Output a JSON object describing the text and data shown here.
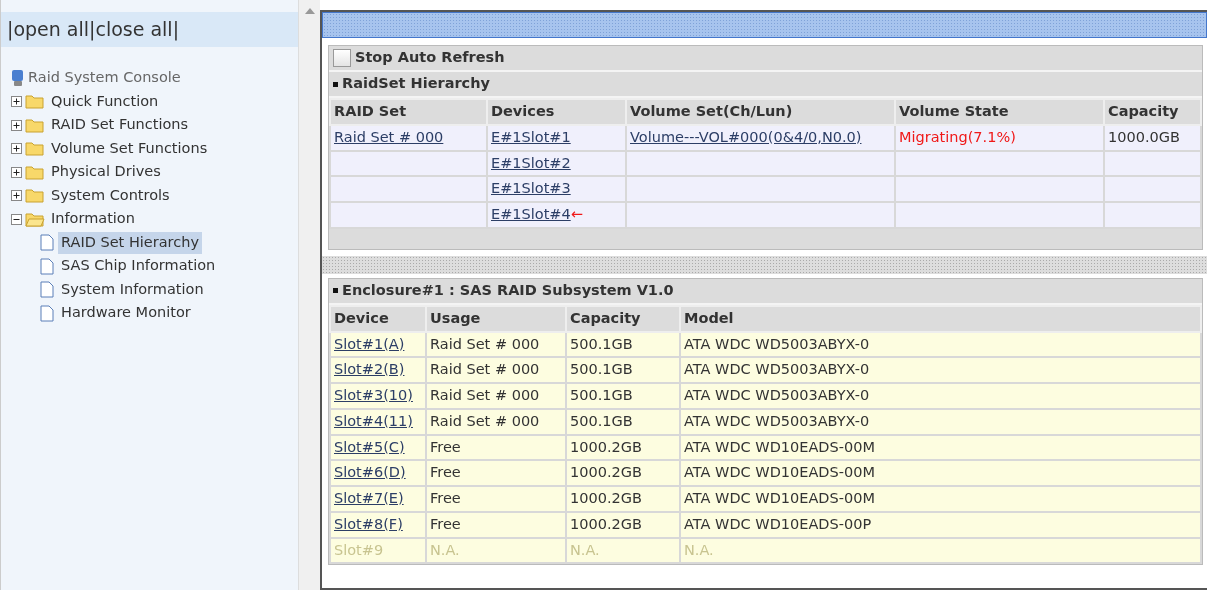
{
  "sidebar": {
    "header_links": [
      "|open all|close all|"
    ],
    "root": "Raid System Console",
    "items": [
      {
        "label": "Quick Function",
        "expanded": false
      },
      {
        "label": "RAID Set Functions",
        "expanded": false
      },
      {
        "label": "Volume Set Functions",
        "expanded": false
      },
      {
        "label": "Physical Drives",
        "expanded": false
      },
      {
        "label": "System Controls",
        "expanded": false
      },
      {
        "label": "Information",
        "expanded": true,
        "children": [
          {
            "label": "RAID Set Hierarchy",
            "selected": true
          },
          {
            "label": "SAS Chip Information",
            "selected": false
          },
          {
            "label": "System Information",
            "selected": false
          },
          {
            "label": "Hardware Monitor",
            "selected": false
          }
        ]
      }
    ]
  },
  "stop_auto_refresh": {
    "label": "Stop Auto Refresh",
    "checked": false
  },
  "raidset": {
    "title": "RaidSet Hierarchy",
    "columns": [
      "RAID Set",
      "Devices",
      "Volume Set(Ch/Lun)",
      "Volume State",
      "Capacity"
    ],
    "rows": [
      {
        "raid_set": "Raid Set # 000",
        "device": "E#1Slot#1",
        "volume_set": "Volume---VOL#000(0&4/0,N0.0)",
        "volume_state": "Migrating(7.1%)",
        "capacity": "1000.0GB"
      },
      {
        "device": "E#1Slot#2"
      },
      {
        "device": "E#1Slot#3"
      },
      {
        "device": "E#1Slot#4",
        "marker": "←"
      }
    ]
  },
  "enclosure": {
    "title": "Enclosure#1 : SAS RAID Subsystem V1.0",
    "columns": [
      "Device",
      "Usage",
      "Capacity",
      "Model"
    ],
    "rows": [
      {
        "device": "Slot#1(A)",
        "usage": "Raid Set # 000",
        "capacity": "500.1GB",
        "model": "ATA WDC WD5003ABYX-0",
        "disabled": false
      },
      {
        "device": "Slot#2(B)",
        "usage": "Raid Set # 000",
        "capacity": "500.1GB",
        "model": "ATA WDC WD5003ABYX-0",
        "disabled": false
      },
      {
        "device": "Slot#3(10)",
        "usage": "Raid Set # 000",
        "capacity": "500.1GB",
        "model": "ATA WDC WD5003ABYX-0",
        "disabled": false
      },
      {
        "device": "Slot#4(11)",
        "usage": "Raid Set # 000",
        "capacity": "500.1GB",
        "model": "ATA WDC WD5003ABYX-0",
        "disabled": false
      },
      {
        "device": "Slot#5(C)",
        "usage": "Free",
        "capacity": "1000.2GB",
        "model": "ATA WDC WD10EADS-00M",
        "disabled": false
      },
      {
        "device": "Slot#6(D)",
        "usage": "Free",
        "capacity": "1000.2GB",
        "model": "ATA WDC WD10EADS-00M",
        "disabled": false
      },
      {
        "device": "Slot#7(E)",
        "usage": "Free",
        "capacity": "1000.2GB",
        "model": "ATA WDC WD10EADS-00M",
        "disabled": false
      },
      {
        "device": "Slot#8(F)",
        "usage": "Free",
        "capacity": "1000.2GB",
        "model": "ATA WDC WD10EADS-00P",
        "disabled": false
      },
      {
        "device": "Slot#9",
        "usage": "N.A.",
        "capacity": "N.A.",
        "model": "N.A.",
        "disabled": true
      }
    ]
  }
}
